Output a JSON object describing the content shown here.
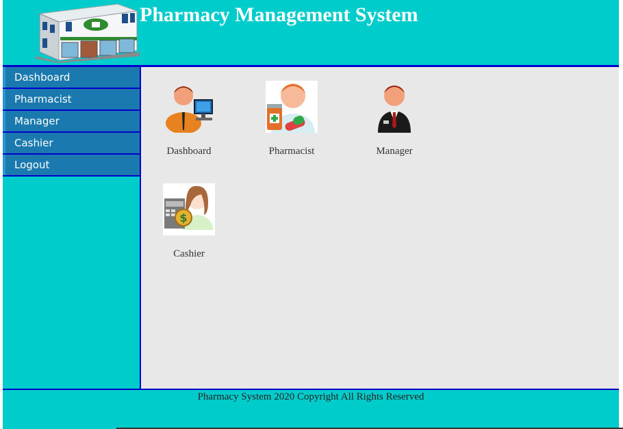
{
  "header": {
    "title": "Pharmacy Management System"
  },
  "sidebar": {
    "items": [
      {
        "label": "Dashboard"
      },
      {
        "label": "Pharmacist"
      },
      {
        "label": "Manager"
      },
      {
        "label": "Cashier"
      },
      {
        "label": "Logout"
      }
    ]
  },
  "main": {
    "tiles": [
      {
        "label": "Dashboard",
        "icon": "admin-computer-icon"
      },
      {
        "label": "Pharmacist",
        "icon": "pharmacist-icon"
      },
      {
        "label": "Manager",
        "icon": "manager-icon"
      },
      {
        "label": "Cashier",
        "icon": "cashier-icon"
      }
    ]
  },
  "footer": {
    "text": "Pharmacy System 2020 Copyright All Rights Reserved"
  },
  "colors": {
    "accent": "#00cccc",
    "border": "#0000cc",
    "nav": "#1a7ab0",
    "content_bg": "#e8e8e8"
  }
}
